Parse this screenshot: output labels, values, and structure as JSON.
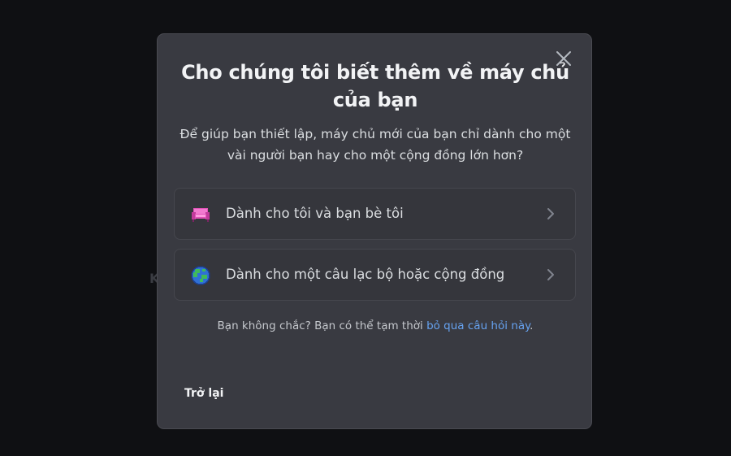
{
  "modal": {
    "title": "Cho chúng tôi biết thêm về máy chủ của bạn",
    "subtitle": "Để giúp bạn thiết lập, máy chủ mới của bạn chỉ dành cho một vài người bạn hay cho một cộng đồng lớn hơn?",
    "options": [
      {
        "label": "Dành cho tôi và bạn bè tôi",
        "icon": "couch-icon"
      },
      {
        "label": "Dành cho một câu lạc bộ hoặc cộng đồng",
        "icon": "globe-icon"
      }
    ],
    "hint_prefix": "Bạn không chắc? Bạn có thể tạm thời ",
    "hint_link": "bỏ qua câu hỏi này",
    "hint_suffix": ".",
    "back_label": "Trở lại",
    "close_icon": "close-icon"
  },
  "background": {
    "partial_letter": "K"
  },
  "colors": {
    "modal_bg": "#393a41",
    "option_bg": "#35363c",
    "link": "#66a2f0",
    "backdrop": "#0f1013"
  }
}
